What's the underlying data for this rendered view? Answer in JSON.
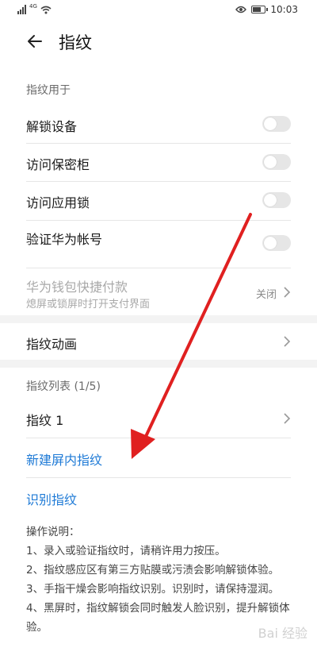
{
  "status_bar": {
    "signal_text": "4G",
    "time": "10:03",
    "battery_level": 0.8,
    "icons": [
      "signal-icon",
      "wifi-icon",
      "eye-icon",
      "battery-icon"
    ]
  },
  "header": {
    "title": "指纹",
    "back_icon": "back-arrow-icon"
  },
  "usage": {
    "section_label": "指纹用于",
    "items": [
      {
        "label": "解锁设备",
        "enabled": false
      },
      {
        "label": "访问保密柜",
        "enabled": false
      },
      {
        "label": "访问应用锁",
        "enabled": false
      },
      {
        "label": "验证华为帐号",
        "enabled": false
      }
    ],
    "wallet": {
      "label": "华为钱包快捷付款",
      "subtitle": "熄屏或锁屏时打开支付界面",
      "value": "关闭"
    }
  },
  "animation": {
    "label": "指纹动画"
  },
  "fingerprints": {
    "section_label": "指纹列表 (1/5)",
    "items": [
      {
        "label": "指纹 1"
      }
    ],
    "add_label": "新建屏内指纹",
    "identify_label": "识别指纹"
  },
  "instructions": {
    "title": "操作说明：",
    "lines": [
      "1、录入或验证指纹时，请稍许用力按压。",
      "2、指纹感应区有第三方贴膜或污渍会影响解锁体验。",
      "3、手指干燥会影响指纹识别。识别时，请保持湿润。",
      "4、黑屏时，指纹解锁会同时触发人脸识别，提升解锁体验。"
    ]
  },
  "colors": {
    "accent": "#1e7ad6",
    "annotation_arrow": "#e02020",
    "switch_off": "#e6e6e6"
  },
  "watermark": "Bai 经验"
}
